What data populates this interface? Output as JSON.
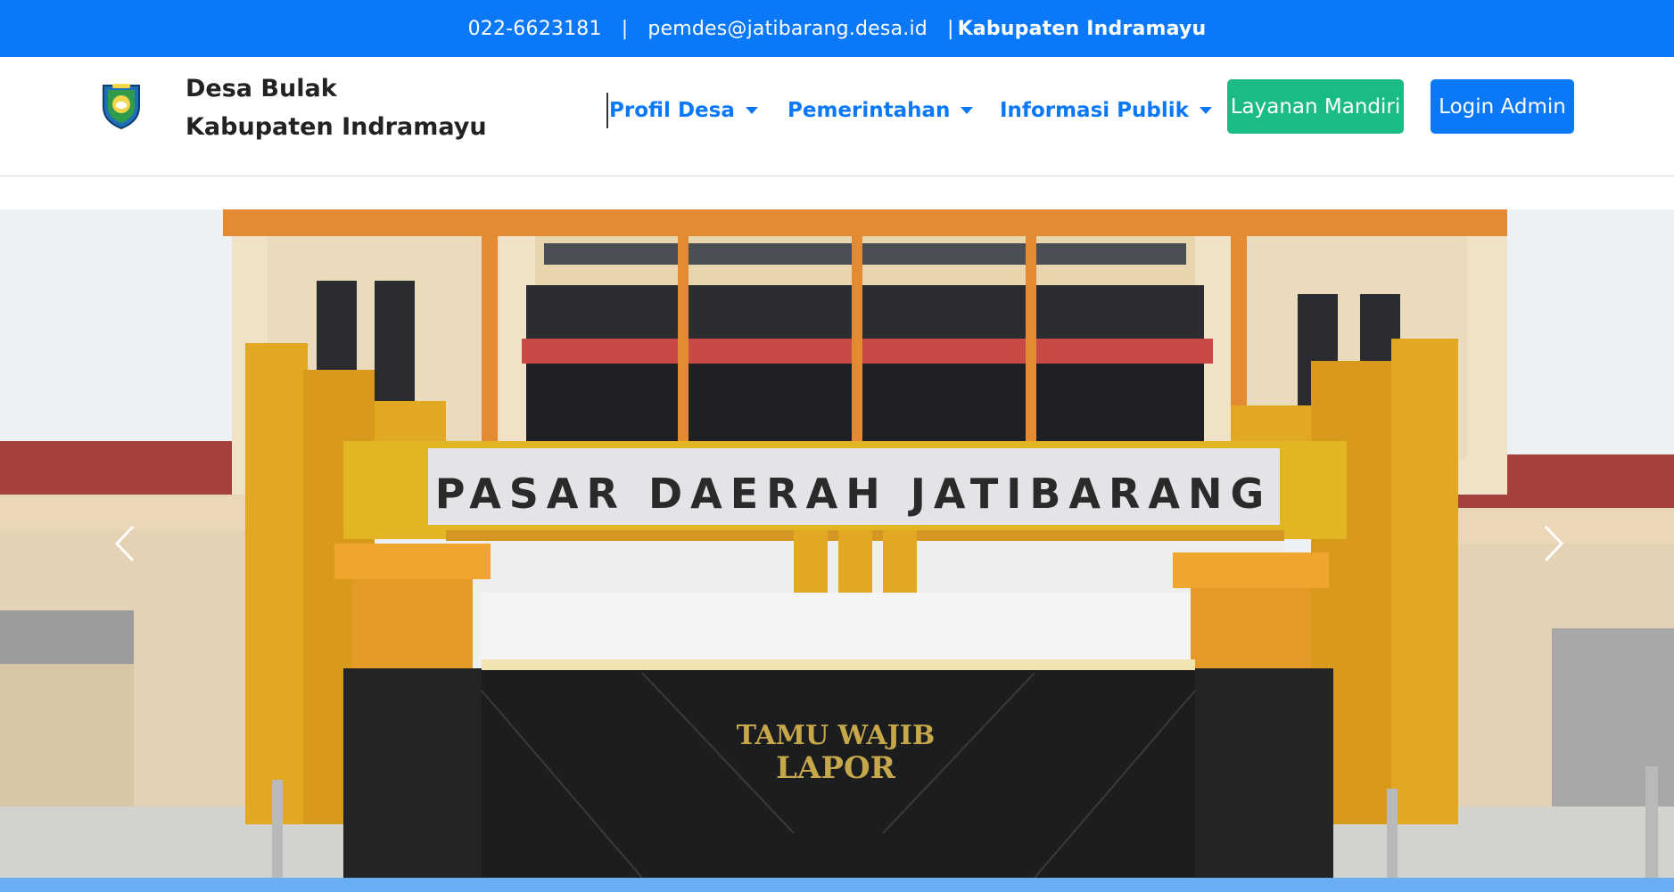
{
  "topbar": {
    "phone": "022-6623181",
    "separator": "|",
    "email": "pemdes@jatibarang.desa.id",
    "regency": "Kabupaten Indramayu",
    "background": "#0b79f7"
  },
  "brand": {
    "logo_icon": "village-emblem-icon",
    "line1": "Desa Bulak",
    "line2": "Kabupaten Indramayu"
  },
  "nav": {
    "items": [
      {
        "label": "Profil Desa",
        "icon": "caret-down-icon"
      },
      {
        "label": "Pemerintahan",
        "icon": "caret-down-icon"
      },
      {
        "label": "Informasi Publik",
        "icon": "caret-down-icon"
      }
    ],
    "link_color": "#0b79f7"
  },
  "buttons": {
    "layanan": {
      "label": "Layanan Mandiri",
      "color": "#1abc84"
    },
    "login": {
      "label": "Login Admin",
      "color": "#0b79f7"
    }
  },
  "hero": {
    "sign_text": "PASAR DAERAH JATIBARANG",
    "wall_text_line1": "TAMU WAJIB",
    "wall_text_line2": "LAPOR",
    "prev_icon": "chevron-left-icon",
    "next_icon": "chevron-right-icon"
  }
}
